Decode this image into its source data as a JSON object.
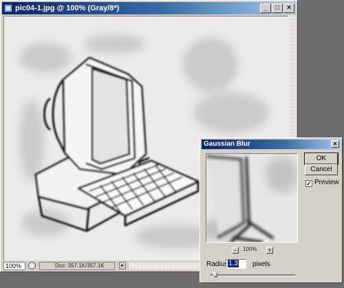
{
  "document_window": {
    "title": "pic04-1.jpg @ 100% (Gray/8*)",
    "controls": {
      "minimize": "_",
      "maximize": "□",
      "close": "×"
    },
    "status": {
      "zoom": "100%",
      "doc_info": "Doc: 357.1K/357.1K"
    }
  },
  "gaussian_blur": {
    "title": "Gaussian Blur",
    "ok_label": "OK",
    "cancel_label": "Cancel",
    "preview_label": "Preview",
    "preview_checked": true,
    "preview_zoom": "100%",
    "zoom_out": "-",
    "zoom_in": "+",
    "radius_label": "Radius:",
    "radius_value": "1.3",
    "radius_unit": "pixels",
    "radius_slider_fraction": 0.04
  },
  "colors": {
    "desktop": "#6e6e6e",
    "chrome": "#d4d0c8",
    "title_active": "#0a246a",
    "canvas": "#ebebeb"
  }
}
